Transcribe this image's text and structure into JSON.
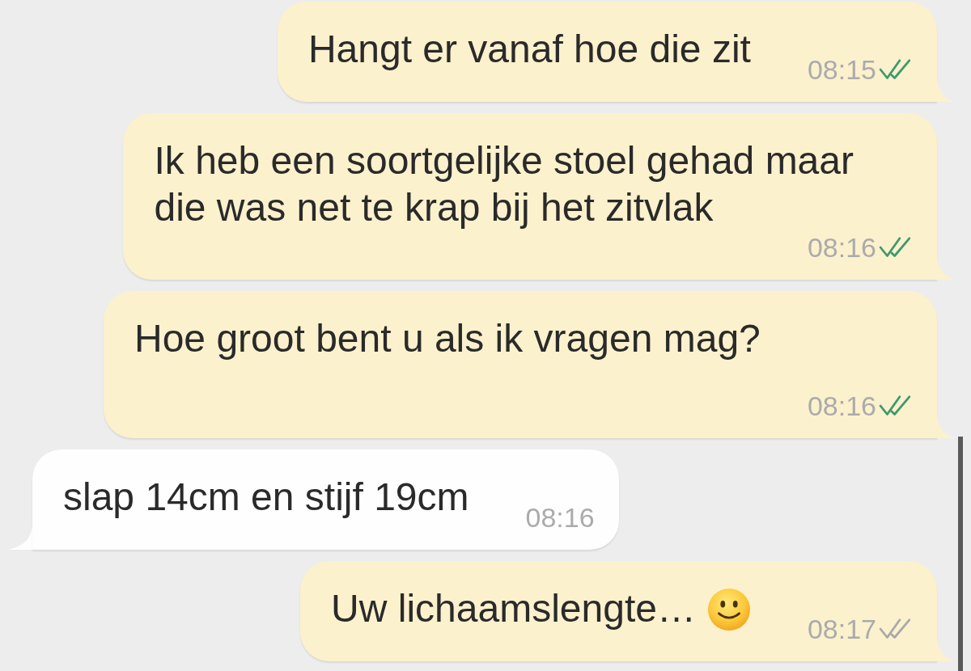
{
  "messages": [
    {
      "kind": "outgoing",
      "text": "Hangt er vanaf hoe die zit",
      "time": "08:15",
      "read": true
    },
    {
      "kind": "outgoing",
      "text": "Ik heb een soortgelijke stoel gehad maar\ndie was net te krap bij het zitvlak",
      "time": "08:16",
      "read": true
    },
    {
      "kind": "outgoing",
      "text": "Hoe groot bent u als ik vragen mag?",
      "time": "08:16",
      "read": true
    },
    {
      "kind": "incoming",
      "text": "slap 14cm en stijf 19cm",
      "time": "08:16"
    },
    {
      "kind": "outgoing",
      "text": "Uw lichaamslengte…",
      "trailing": [
        {
          "kind": "emoji"
        }
      ],
      "time": "08:17",
      "read": false
    }
  ]
}
